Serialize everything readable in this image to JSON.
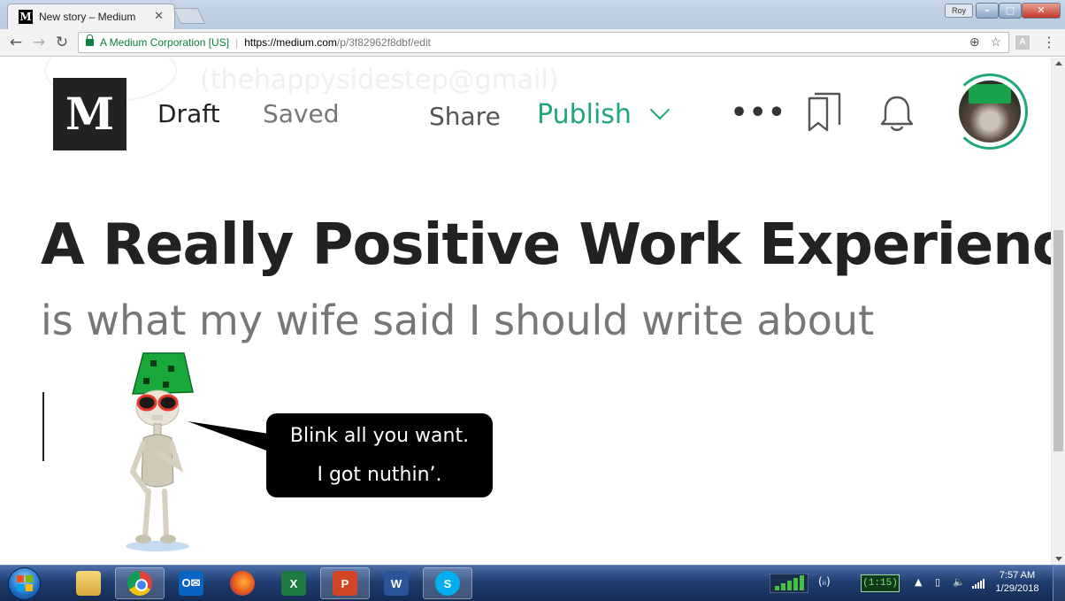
{
  "browser": {
    "tab_title": "New story – Medium",
    "tab_favicon": "M",
    "tab_close": "✕",
    "profile_name": "Roy",
    "window_controls": {
      "minimize": "–",
      "maximize": "□",
      "close": "✕"
    },
    "nav": {
      "back": "←",
      "forward": "→",
      "reload": "↻"
    },
    "omnibox": {
      "org": "A Medium Corporation [US]",
      "separator": "|",
      "url_scheme_host": "https://medium.com",
      "url_path": "/p/3f82962f8dbf/edit",
      "zoom_icon": "⊕",
      "star_icon": "☆"
    },
    "extension_icon": "A",
    "menu_icon": "⋮"
  },
  "editor": {
    "background_ghost": "(thehappysidestep@gmail)",
    "logo": "M",
    "status_draft": "Draft",
    "status_saved": "Saved",
    "share_label": "Share",
    "publish_label": "Publish",
    "more_label": "•••",
    "story_title": "A Really Positive Work Experience",
    "story_subtitle": "is what my wife said I should write about",
    "speech_bubble": {
      "line1": "Blink all you want.",
      "line2": "I got nuthin’."
    },
    "accent_color": "#1fa67a"
  },
  "taskbar": {
    "apps": [
      {
        "name": "Windows Explorer",
        "icon": "folder-icon",
        "glyph": ""
      },
      {
        "name": "Google Chrome",
        "icon": "chrome-icon",
        "glyph": "",
        "active": true
      },
      {
        "name": "Outlook",
        "icon": "outlook-icon",
        "glyph": "O✉"
      },
      {
        "name": "Firefox",
        "icon": "firefox-icon",
        "glyph": ""
      },
      {
        "name": "Excel",
        "icon": "excel-icon",
        "glyph": "X"
      },
      {
        "name": "PowerPoint",
        "icon": "powerpoint-icon",
        "glyph": "P",
        "active": true
      },
      {
        "name": "Word",
        "icon": "word-icon",
        "glyph": "W"
      },
      {
        "name": "Skype",
        "icon": "skype-icon",
        "glyph": "S",
        "active": true
      }
    ],
    "network_label": "(ᵢᵢ)",
    "battery_label": "(1:15)",
    "tray_arrow": "▲",
    "tray_volume": "🔈",
    "clock_time": "7:57 AM",
    "clock_date": "1/29/2018"
  }
}
